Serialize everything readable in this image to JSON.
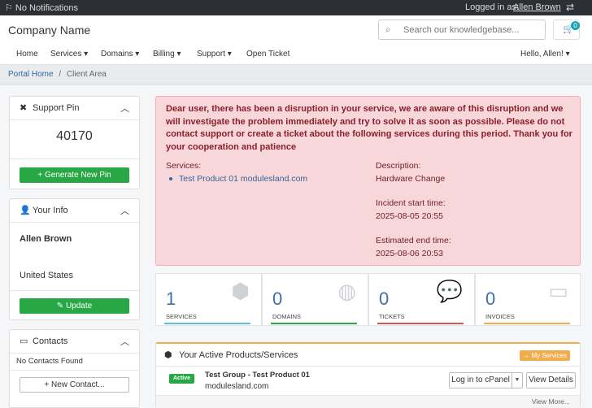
{
  "topbar": {
    "notifications": "No Notifications",
    "logged_in_label": "Logged in as:",
    "user": "Allen Brown"
  },
  "header": {
    "brand": "Company Name",
    "search_placeholder": "Search our knowledgebase...",
    "cart_count": "0",
    "nav": [
      "Home",
      "Services ▾",
      "Domains ▾",
      "Billing ▾",
      "Support ▾",
      "Open Ticket"
    ],
    "hello": "Hello, Allen! ▾"
  },
  "breadcrumb": {
    "home": "Portal Home",
    "separator": "/",
    "current": "Client Area"
  },
  "sidebar": {
    "support_pin": {
      "title": "Support Pin",
      "pin": "40170",
      "button": "Generate New Pin"
    },
    "your_info": {
      "title": "Your Info",
      "name": "Allen Brown",
      "country": "United States",
      "button": "Update"
    },
    "contacts": {
      "title": "Contacts",
      "empty": "No Contacts Found",
      "button": "New Contact..."
    }
  },
  "alert": {
    "message": "Dear user, there has been a disruption in your service, we are aware of this disruption and we will investigate the problem immediately and try to solve it as soon as possible. Please do not contact support or create a ticket about the following services during this period. Thank you for your cooperation and patience",
    "services_label": "Services:",
    "service": "Test Product 01 modulesland.com",
    "description_label": "Description:",
    "description": "Hardware Change",
    "start_label": "Incident start time:",
    "start": "2025-08-05 20:55",
    "end_label": "Estimated end time:",
    "end": "2025-08-06 20:53"
  },
  "stats": [
    {
      "value": "1",
      "label": "SERVICES",
      "color": "#5bc0de"
    },
    {
      "value": "0",
      "label": "DOMAINS",
      "color": "#28a745"
    },
    {
      "value": "0",
      "label": "TICKETS",
      "color": "#d9534f"
    },
    {
      "value": "0",
      "label": "INVOICES",
      "color": "#f0ad4e"
    }
  ],
  "products": {
    "title": "Your Active Products/Services",
    "my_services": "My Services",
    "status": "Active",
    "name": "Test Group - Test Product 01",
    "domain": "modulesland.com",
    "login_button": "Log in to cPanel",
    "details_button": "View Details",
    "view_more": "View More..."
  },
  "colors": {
    "accent_blue": "#336699",
    "green": "#28a745",
    "alert_bg": "#f8d7da",
    "orange": "#f0ad4e"
  }
}
